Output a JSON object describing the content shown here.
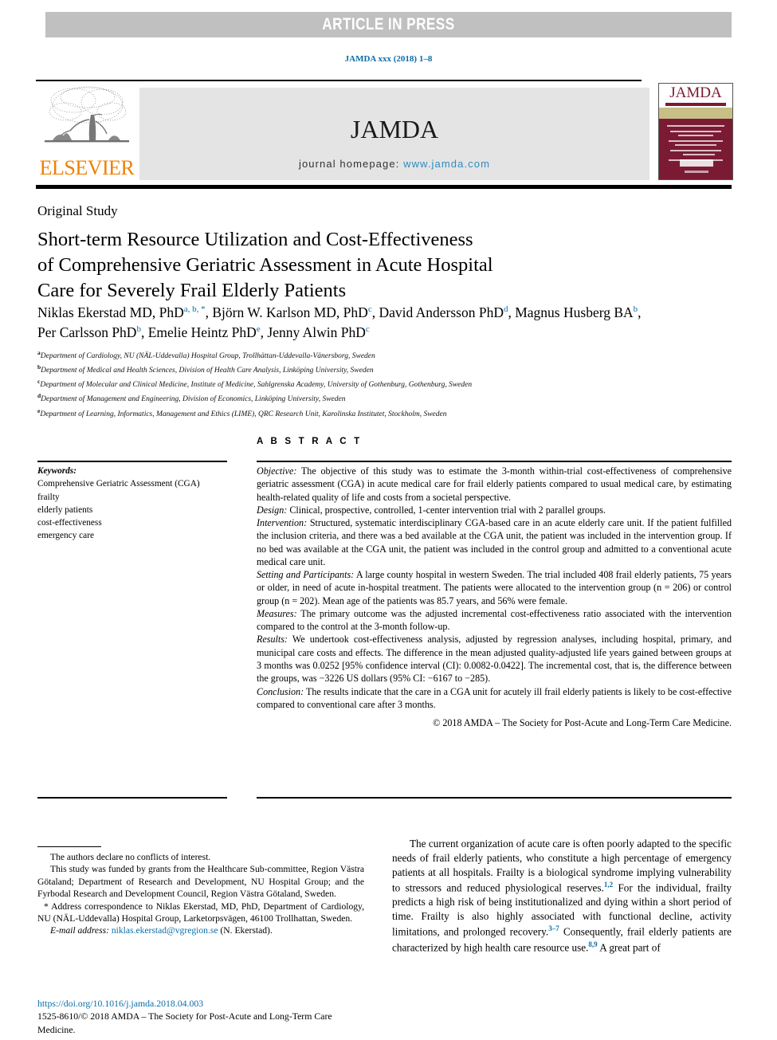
{
  "banner": {
    "label": "ARTICLE IN PRESS"
  },
  "citation": "JAMDA xxx (2018) 1–8",
  "masthead": {
    "publisher_name": "ELSEVIER",
    "publisher_logo": "elsevier-tree-logo",
    "journal_title": "JAMDA",
    "homepage_label": "journal homepage:",
    "homepage_url": "www.jamda.com",
    "cover_title": "JAMDA",
    "cover_color": "#7b1b33",
    "cover_band_color": "#c8bf86",
    "link_color": "#2b8cbe"
  },
  "article": {
    "section_type": "Original Study",
    "title_lines": [
      "Short-term Resource Utilization and Cost-Effectiveness",
      "of Comprehensive Geriatric Assessment in Acute Hospital",
      "Care for Severely Frail Elderly Patients"
    ],
    "authors": [
      {
        "name": "Niklas Ekerstad MD, PhD",
        "marks": "a, b, *",
        "sep": ", "
      },
      {
        "name": "Björn W. Karlson MD, PhD",
        "marks": "c",
        "sep": ", "
      },
      {
        "name": "David Andersson PhD",
        "marks": "d",
        "sep": ", "
      },
      {
        "name": "Magnus Husberg BA",
        "marks": "b",
        "sep": ", "
      },
      {
        "name": "Per Carlsson PhD",
        "marks": "b",
        "sep": ", "
      },
      {
        "name": "Emelie Heintz PhD",
        "marks": "e",
        "sep": ", "
      },
      {
        "name": "Jenny Alwin PhD",
        "marks": "c",
        "sep": ""
      }
    ],
    "affiliations": [
      {
        "mark": "a",
        "text": "Department of Cardiology, NU (NÄL-Uddevalla) Hospital Group, Trollhättan-Uddevalla-Vänersborg, Sweden"
      },
      {
        "mark": "b",
        "text": "Department of Medical and Health Sciences, Division of Health Care Analysis, Linköping University, Sweden"
      },
      {
        "mark": "c",
        "text": "Department of Molecular and Clinical Medicine, Institute of Medicine, Sahlgrenska Academy, University of Gothenburg, Gothenburg, Sweden"
      },
      {
        "mark": "d",
        "text": "Department of Management and Engineering, Division of Economics, Linköping University, Sweden"
      },
      {
        "mark": "e",
        "text": "Department of Learning, Informatics, Management and Ethics (LIME), QRC Research Unit, Karolinska Institutet, Stockholm, Sweden"
      }
    ]
  },
  "keywords": {
    "heading": "Keywords:",
    "items": [
      "Comprehensive Geriatric Assessment (CGA)",
      "frailty",
      "elderly patients",
      "cost-effectiveness",
      "emergency care"
    ]
  },
  "abstract": {
    "label": "A B S T R A C T",
    "sections": [
      {
        "heading": "Objective:",
        "text": " The objective of this study was to estimate the 3-month within-trial cost-effectiveness of comprehensive geriatric assessment (CGA) in acute medical care for frail elderly patients compared to usual medical care, by estimating health-related quality of life and costs from a societal perspective."
      },
      {
        "heading": "Design:",
        "text": " Clinical, prospective, controlled, 1-center intervention trial with 2 parallel groups."
      },
      {
        "heading": "Intervention:",
        "text": " Structured, systematic interdisciplinary CGA-based care in an acute elderly care unit. If the patient fulfilled the inclusion criteria, and there was a bed available at the CGA unit, the patient was included in the intervention group. If no bed was available at the CGA unit, the patient was included in the control group and admitted to a conventional acute medical care unit."
      },
      {
        "heading": "Setting and Participants:",
        "text": " A large county hospital in western Sweden. The trial included 408 frail elderly patients, 75 years or older, in need of acute in-hospital treatment. The patients were allocated to the intervention group (n = 206) or control group (n = 202). Mean age of the patients was 85.7 years, and 56% were female."
      },
      {
        "heading": "Measures:",
        "text": " The primary outcome was the adjusted incremental cost-effectiveness ratio associated with the intervention compared to the control at the 3-month follow-up."
      },
      {
        "heading": "Results:",
        "text": " We undertook cost-effectiveness analysis, adjusted by regression analyses, including hospital, primary, and municipal care costs and effects. The difference in the mean adjusted quality-adjusted life years gained between groups at 3 months was 0.0252 [95% confidence interval (CI): 0.0082-0.0422]. The incremental cost, that is, the difference between the groups, was −3226 US dollars (95% CI: −6167 to −285)."
      },
      {
        "heading": "Conclusion:",
        "text": " The results indicate that the care in a CGA unit for acutely ill frail elderly patients is likely to be cost-effective compared to conventional care after 3 months."
      }
    ],
    "copyright": "© 2018 AMDA – The Society for Post-Acute and Long-Term Care Medicine."
  },
  "footnotes": {
    "conflicts": "The authors declare no conflicts of interest.",
    "funding": "This study was funded by grants from the Healthcare Sub-committee, Region Västra Götaland; Department of Research and Development, NU Hospital Group; and the Fyrbodal Research and Development Council, Region Västra Götaland, Sweden.",
    "correspondence_mark": "*",
    "correspondence": " Address correspondence to Niklas Ekerstad, MD, PhD, Department of Cardiology, NU (NÄL-Uddevalla) Hospital Group, Larketorpsvägen, 46100 Trollhattan, Sweden.",
    "email_label": "E-mail address:",
    "email": "niklas.ekerstad@vgregion.se",
    "email_suffix": " (N. Ekerstad)."
  },
  "doi_block": {
    "doi": "https://doi.org/10.1016/j.jamda.2018.04.003",
    "issn_line": "1525-8610/© 2018 AMDA – The Society for Post-Acute and Long-Term Care Medicine."
  },
  "body": {
    "paragraph_parts": [
      {
        "text": "The current organization of acute care is often poorly adapted to the specific needs of frail elderly patients, who constitute a high percentage of emergency patients at all hospitals. Frailty is a biological syndrome implying vulnerability to stressors and reduced physiological reserves."
      },
      {
        "ref": "1,2"
      },
      {
        "text": " For the individual, frailty predicts a high risk of being institutionalized and dying within a short period of time. Frailty is also highly associated with functional decline, activity limitations, and prolonged recovery."
      },
      {
        "ref": "3–7"
      },
      {
        "text": " Consequently, frail elderly patients are characterized by high health care resource use."
      },
      {
        "ref": "8,9"
      },
      {
        "text": " A great part of"
      }
    ]
  }
}
